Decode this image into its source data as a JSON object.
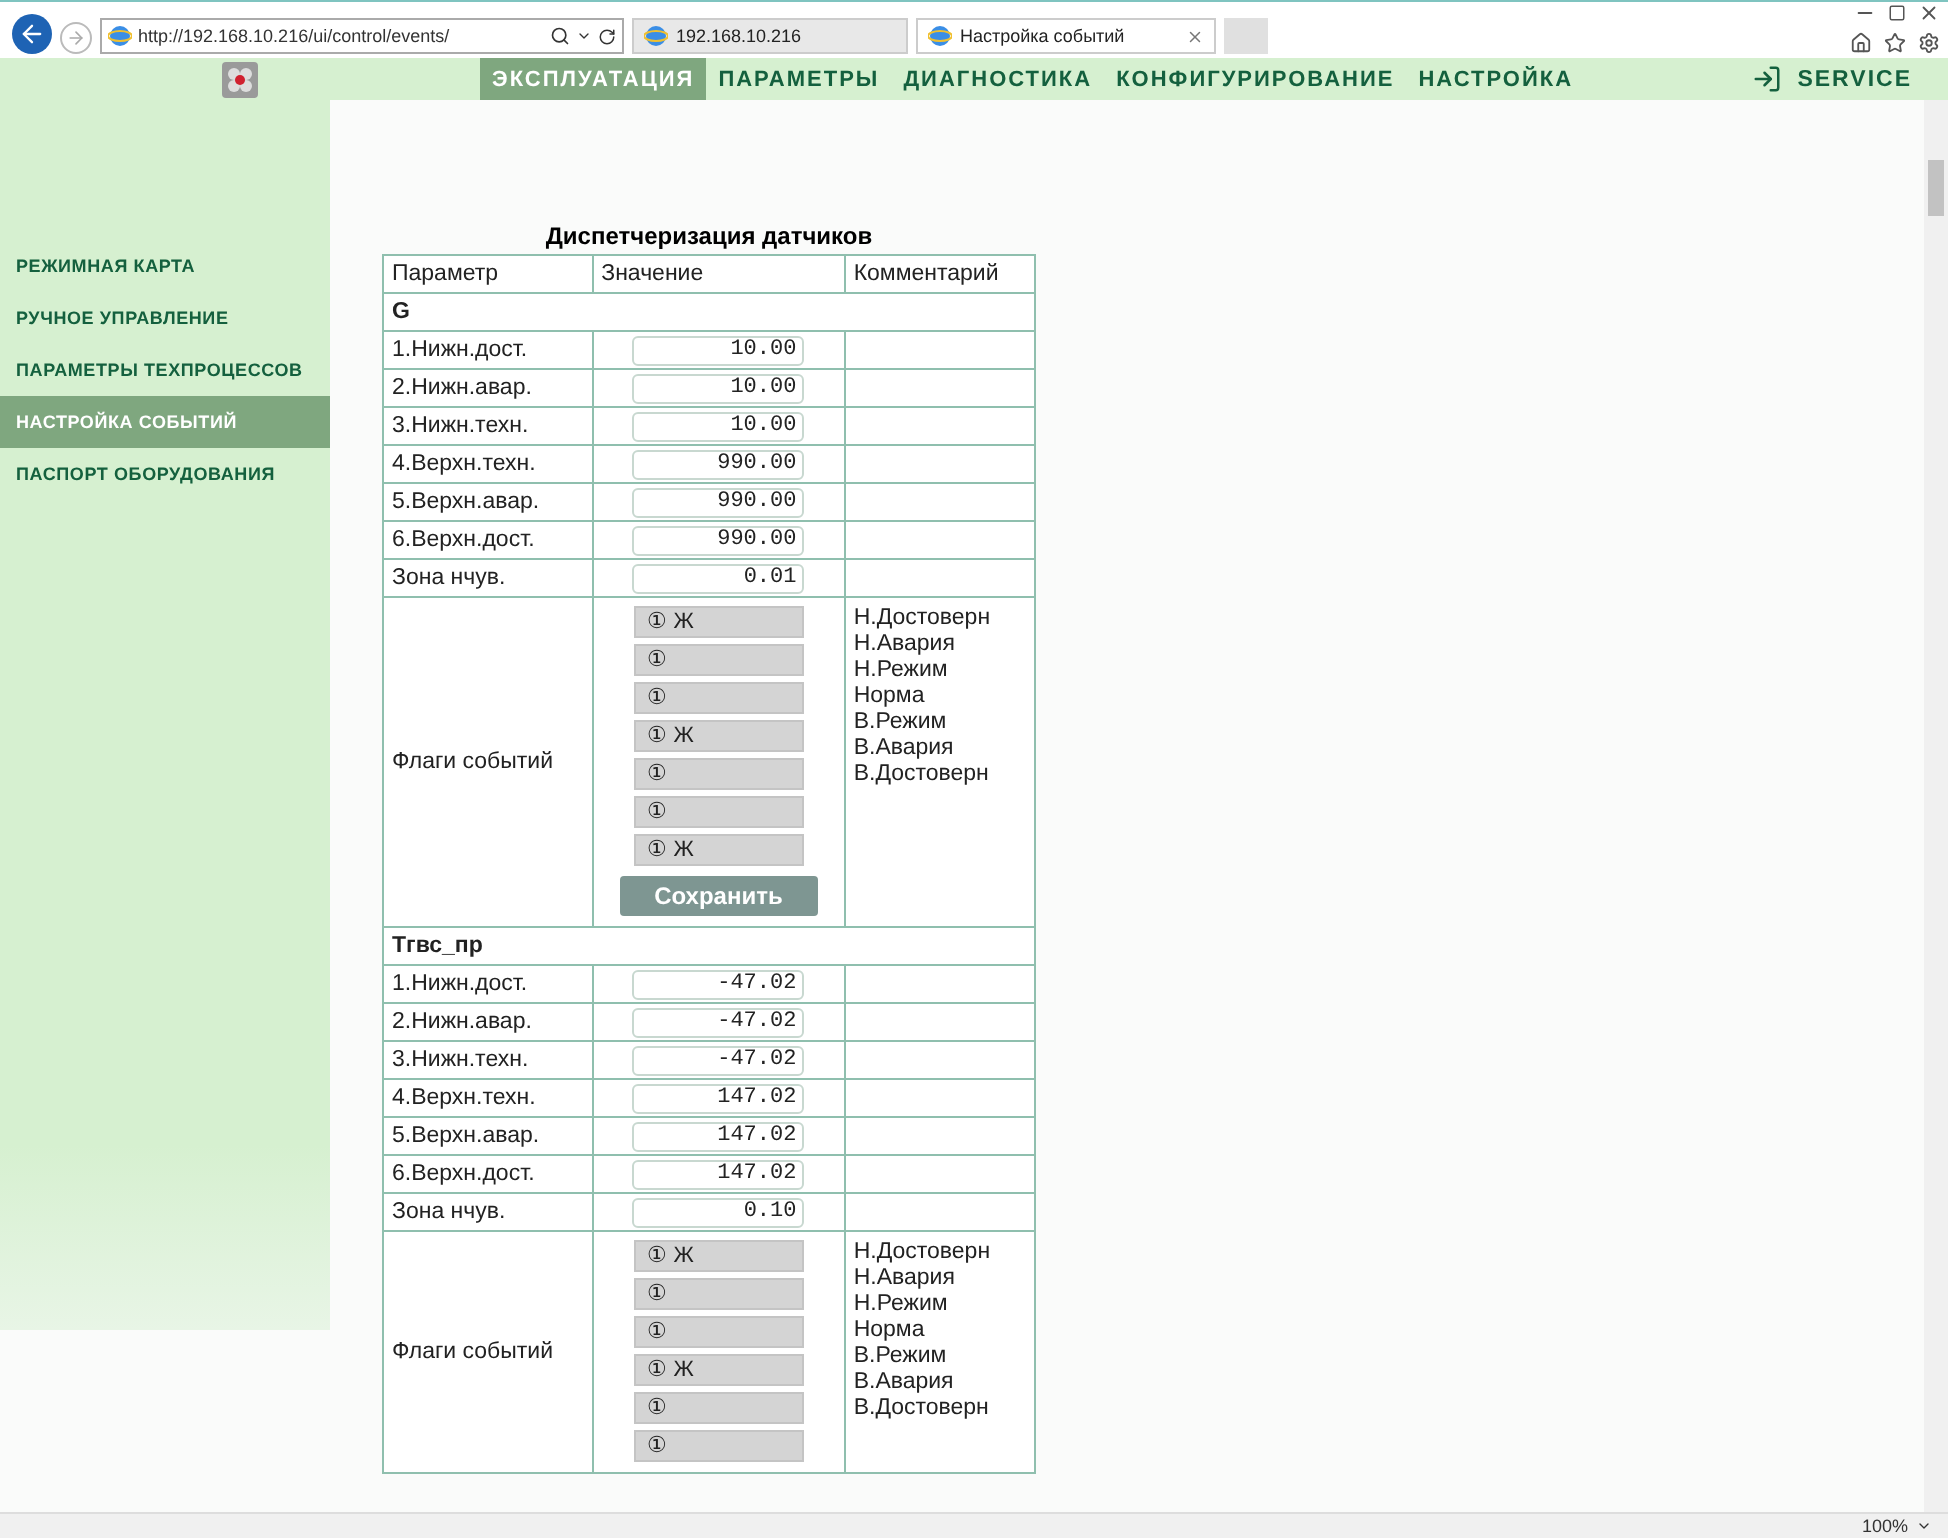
{
  "browser": {
    "address": "http://192.168.10.216/ui/control/events/",
    "tabs": [
      {
        "title": "192.168.10.216",
        "selected": false,
        "closable": false
      },
      {
        "title": "Настройка событий",
        "selected": true,
        "closable": true
      }
    ],
    "zoom": "100%"
  },
  "nav": {
    "items": [
      {
        "label": "ЭКСПЛУАТАЦИЯ",
        "selected": true
      },
      {
        "label": "ПАРАМЕТРЫ",
        "selected": false
      },
      {
        "label": "ДИАГНОСТИКА",
        "selected": false
      },
      {
        "label": "КОНФИГУРИРОВАНИЕ",
        "selected": false
      },
      {
        "label": "НАСТРОЙКА",
        "selected": false
      }
    ],
    "service": "SERVICE"
  },
  "sidebar": {
    "items": [
      {
        "label": "РЕЖИМНАЯ КАРТА",
        "selected": false
      },
      {
        "label": "РУЧНОЕ УПРАВЛЕНИЕ",
        "selected": false
      },
      {
        "label": "ПАРАМЕТРЫ ТЕХПРОЦЕССОВ",
        "selected": false
      },
      {
        "label": "НАСТРОЙКА СОБЫТИЙ",
        "selected": true
      },
      {
        "label": "ПАСПОРТ ОБОРУДОВАНИЯ",
        "selected": false
      }
    ]
  },
  "table": {
    "title": "Диспетчеризация датчиков",
    "columns": [
      "Параметр",
      "Значение",
      "Комментарий"
    ],
    "groups": [
      {
        "name": "G",
        "params": [
          {
            "label": "1.Нижн.дост.",
            "value": "10.00"
          },
          {
            "label": "2.Нижн.авар.",
            "value": "10.00"
          },
          {
            "label": "3.Нижн.техн.",
            "value": "10.00"
          },
          {
            "label": "4.Верхн.техн.",
            "value": "990.00"
          },
          {
            "label": "5.Верхн.авар.",
            "value": "990.00"
          },
          {
            "label": "6.Верхн.дост.",
            "value": "990.00"
          },
          {
            "label": "Зона нчув.",
            "value": "0.01"
          }
        ],
        "flags_label": "Флаги событий",
        "flags": [
          {
            "label": "① Ж"
          },
          {
            "label": "①"
          },
          {
            "label": "①"
          },
          {
            "label": "① Ж"
          },
          {
            "label": "①"
          },
          {
            "label": "①"
          },
          {
            "label": "① Ж"
          }
        ],
        "comments": [
          "Н.Достоверн",
          "Н.Авария",
          "Н.Режим",
          "Норма",
          "В.Режим",
          "В.Авария",
          "В.Достоверн"
        ],
        "save": "Сохранить"
      },
      {
        "name": "Тгвс_пр",
        "params": [
          {
            "label": "1.Нижн.дост.",
            "value": "-47.02"
          },
          {
            "label": "2.Нижн.авар.",
            "value": "-47.02"
          },
          {
            "label": "3.Нижн.техн.",
            "value": "-47.02"
          },
          {
            "label": "4.Верхн.техн.",
            "value": "147.02"
          },
          {
            "label": "5.Верхн.авар.",
            "value": "147.02"
          },
          {
            "label": "6.Верхн.дост.",
            "value": "147.02"
          },
          {
            "label": "Зона нчув.",
            "value": "0.10"
          }
        ],
        "flags_label": "Флаги событий",
        "flags": [
          {
            "label": "① Ж"
          },
          {
            "label": "①"
          },
          {
            "label": "①"
          },
          {
            "label": "① Ж"
          },
          {
            "label": "①"
          },
          {
            "label": "①"
          }
        ],
        "comments": [
          "Н.Достоверн",
          "Н.Авария",
          "Н.Режим",
          "Норма",
          "В.Режим",
          "В.Авария",
          "В.Достоверн"
        ]
      }
    ]
  }
}
